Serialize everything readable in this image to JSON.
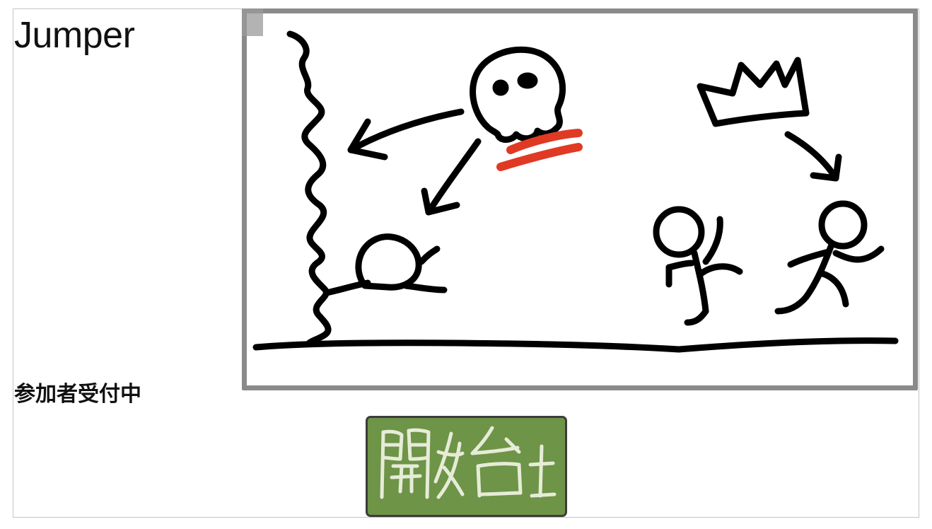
{
  "app": {
    "title": "Jumper"
  },
  "lobby": {
    "status": "参加者受付中"
  },
  "start_button": {
    "label": "開始",
    "background_color": "#6e9447",
    "text_color": "#e6ecd8"
  },
  "illustration": {
    "colors": {
      "ink": "#000000",
      "accent": "#e03a24",
      "frame": "#8a8a8a"
    },
    "icons": [
      "zigzag-wall-icon",
      "skull-icon",
      "crown-icon",
      "stick-figure-icon",
      "arrow-icon",
      "ground-line-icon"
    ]
  }
}
